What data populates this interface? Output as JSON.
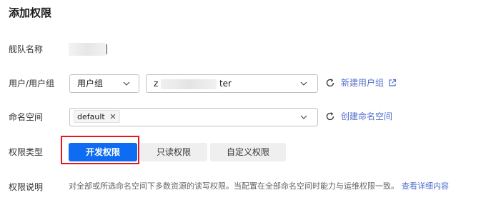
{
  "title": "添加权限",
  "fields": {
    "fleet_name_label": "舰队名称",
    "user_group_label": "用户/用户组",
    "namespace_label": "命名空间",
    "permission_type_label": "权限类型",
    "permission_desc_label": "权限说明"
  },
  "user_group": {
    "type_select_value": "用户组",
    "group_select_prefix": "z",
    "group_select_suffix": "ter",
    "create_link": "新建用户组",
    "refresh_icon": "refresh-icon",
    "external_icon": "external-link-icon"
  },
  "namespace": {
    "tag_value": "default",
    "create_link": "创建命名空间",
    "refresh_icon": "refresh-icon"
  },
  "permission_types": {
    "options": [
      "开发权限",
      "只读权限",
      "自定义权限"
    ],
    "selected": "开发权限"
  },
  "description": {
    "text": "对全部或所选命名空间下多数资源的读写权限。当配置在全部命名空间时能力与运维权限一致。",
    "link": "查看详细内容"
  },
  "colors": {
    "accent": "#0d6cf2",
    "link": "#526ecc",
    "highlight": "#e5161d"
  }
}
